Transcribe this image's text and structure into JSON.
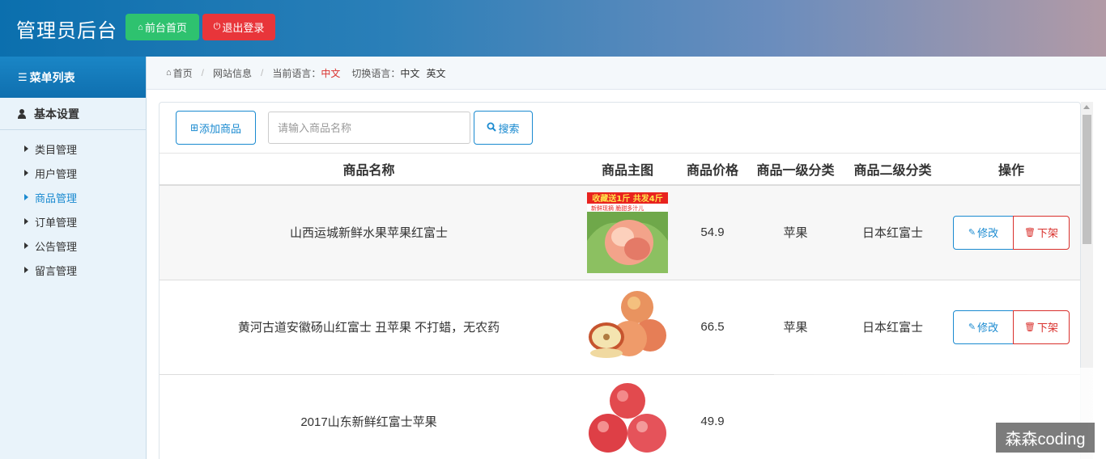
{
  "header": {
    "title": "管理员后台",
    "home_button": "前台首页",
    "logout_button": "退出登录"
  },
  "sidebar": {
    "heading": "菜单列表",
    "group_title": "基本设置",
    "items": [
      {
        "label": "类目管理"
      },
      {
        "label": "用户管理"
      },
      {
        "label": "商品管理"
      },
      {
        "label": "订单管理"
      },
      {
        "label": "公告管理"
      },
      {
        "label": "留言管理"
      }
    ]
  },
  "breadcrumb": {
    "home": "首页",
    "section": "网站信息",
    "current_lang_label": "当前语言：",
    "current_lang": "中文",
    "switch_label": "切换语言：",
    "lang_zh": "中文",
    "lang_en": "英文"
  },
  "toolbar": {
    "add_label": "添加商品",
    "search_placeholder": "请输入商品名称",
    "search_value": "",
    "search_label": "搜索"
  },
  "table": {
    "headers": {
      "name": "商品名称",
      "image": "商品主图",
      "price": "商品价格",
      "cat1": "商品一级分类",
      "cat2": "商品二级分类",
      "ops": "操作"
    },
    "edit_label": "修改",
    "off_label": "下架",
    "rows": [
      {
        "name": "山西运城新鲜水果苹果红富士",
        "price": "54.9",
        "cat1": "苹果",
        "cat2": "日本红富士",
        "image": "peach-promo-image",
        "promo_text": "收藏送1斤 共发4斤",
        "promo_sub": "新鲜现摘 脆甜多汁儿"
      },
      {
        "name": "黄河古道安徽砀山红富士 丑苹果 不打蜡，无农药",
        "price": "66.5",
        "cat1": "苹果",
        "cat2": "日本红富士",
        "image": "apples-cut-image"
      },
      {
        "name": "2017山东新鲜红富士苹果",
        "price": "49.9",
        "cat1": "",
        "cat2": "",
        "image": "red-apples-image"
      }
    ]
  },
  "watermark": "森森coding",
  "colors": {
    "primary": "#1a8ad0",
    "danger": "#d9302c",
    "success": "#2ec26f",
    "logout": "#e8353a"
  }
}
